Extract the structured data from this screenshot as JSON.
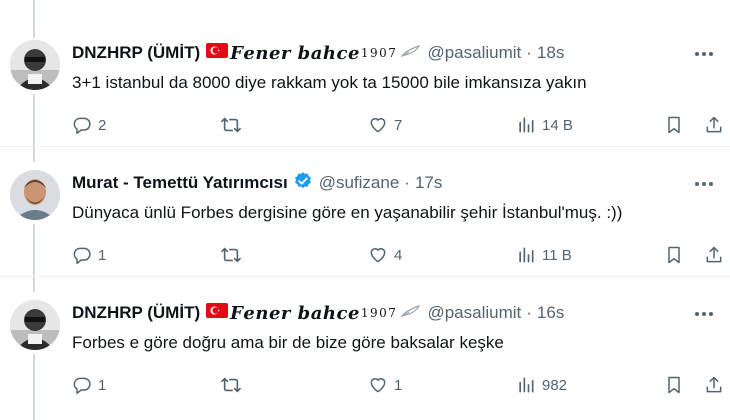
{
  "tweets": [
    {
      "name": "DNZHRP (ÜMİT)",
      "fancy_text": "𝑭𝒆𝒏𝒆𝒓 𝒃𝒂𝒉𝒄𝒆",
      "fancy_sup": "1907",
      "handle": "@pasaliumit",
      "dot": "·",
      "time": "18s",
      "text": "3+1 istanbul da 8000 diye rakkam yok ta 15000 bile imkansıza yakın",
      "replies": "2",
      "reposts": "",
      "likes": "7",
      "views": "14 B",
      "avatar": "bw-portrait"
    },
    {
      "name": "Murat - Temettü Yatırımcısı",
      "handle": "@sufizane",
      "dot": "·",
      "time": "17s",
      "text": "Dünyaca ünlü Forbes dergisine göre en yaşanabilir şehir İstanbul'muş. :))",
      "replies": "1",
      "reposts": "",
      "likes": "4",
      "views": "11 B",
      "verified": true,
      "avatar": "color-portrait"
    },
    {
      "name": "DNZHRP (ÜMİT)",
      "fancy_text": "𝑭𝒆𝒏𝒆𝒓 𝒃𝒂𝒉𝒄𝒆",
      "fancy_sup": "1907",
      "handle": "@pasaliumit",
      "dot": "·",
      "time": "16s",
      "text": "Forbes e göre doğru ama bir de bize göre baksalar keşke",
      "replies": "1",
      "reposts": "",
      "likes": "1",
      "views": "982",
      "avatar": "bw-portrait"
    }
  ],
  "colors": {
    "text": "#0f1419",
    "secondary": "#536471",
    "verified": "#1d9bf0",
    "flag_red": "#e30a17",
    "thread_line": "#cfd9de"
  },
  "icons": [
    "reply-icon",
    "repost-icon",
    "like-icon",
    "views-icon",
    "bookmark-icon",
    "share-icon",
    "more-icon",
    "verified-badge-icon",
    "turkey-flag-icon",
    "quill-icon"
  ]
}
